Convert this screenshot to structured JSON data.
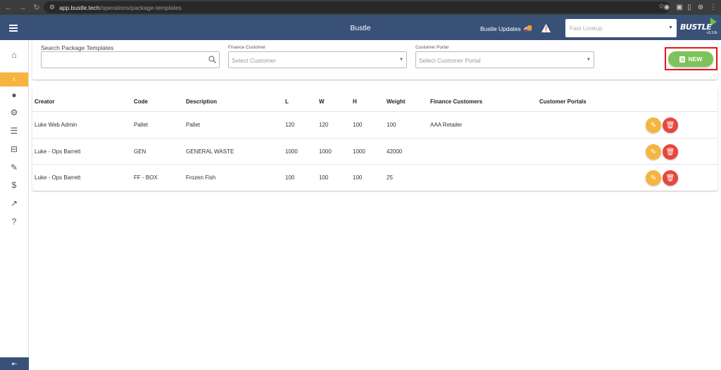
{
  "browser": {
    "url_host": "app.bustle.tech",
    "url_path": "/operations/package-templates"
  },
  "header": {
    "title": "Bustle",
    "updates_label": "Bustle Updates",
    "fast_lookup_placeholder": "Fast Lookup",
    "brand_name": "BUSTLE",
    "brand_version": "v3.3.8r"
  },
  "filters": {
    "search_label": "Search Package Templates",
    "search_value": "",
    "finance_label": "Finance Customer",
    "finance_placeholder": "Select Customer",
    "portal_label": "Customer Portal",
    "portal_placeholder": "Select Customer Portal",
    "new_label": "NEW"
  },
  "table": {
    "columns": [
      "Creator",
      "Code",
      "Description",
      "L",
      "W",
      "H",
      "Weight",
      "Finance Customers",
      "Customer Portals"
    ],
    "rows": [
      {
        "creator": "Luke Web Admin",
        "code": "Pallet",
        "description": "Pallet",
        "l": "120",
        "w": "120",
        "h": "100",
        "weight": "100",
        "finance": "AAA Retailer",
        "portals": ""
      },
      {
        "creator": "Luke - Ops Barrett",
        "code": "GEN",
        "description": "GENERAL WASTE",
        "l": "1000",
        "w": "1000",
        "h": "1000",
        "weight": "42000",
        "finance": "",
        "portals": ""
      },
      {
        "creator": "Luke - Ops Barrett",
        "code": "FF - BOX",
        "description": "Frozen Fish",
        "l": "100",
        "w": "100",
        "h": "100",
        "weight": "25",
        "finance": "",
        "portals": ""
      }
    ]
  },
  "colors": {
    "header_bg": "#3a5177",
    "accent_yellow": "#f5b540",
    "new_green": "#7dc35a",
    "delete_red": "#e8473d"
  }
}
